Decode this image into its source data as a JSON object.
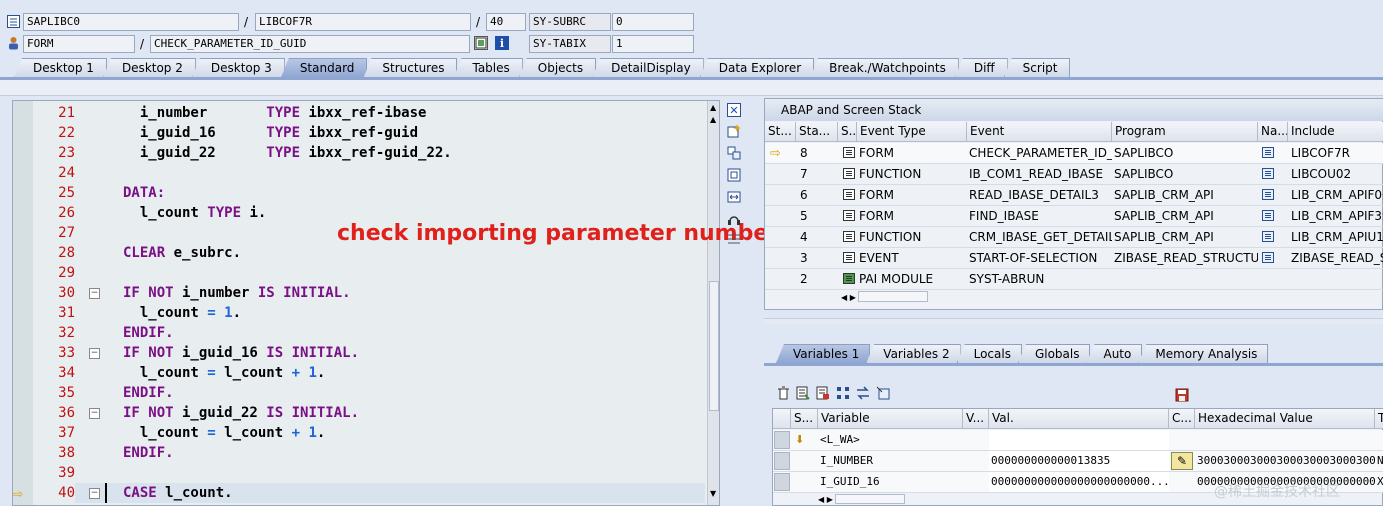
{
  "header": {
    "program": "SAPLIBC0",
    "include": "LIBCOF7R",
    "line": "40",
    "sysubrc_label": "SY-SUBRC",
    "sysubrc_value": "0",
    "type": "FORM",
    "routine": "CHECK_PARAMETER_ID_GUID",
    "sytabix_label": "SY-TABIX",
    "sytabix_value": "1"
  },
  "tabs": [
    "Desktop 1",
    "Desktop 2",
    "Desktop 3",
    "Standard",
    "Structures",
    "Tables",
    "Objects",
    "DetailDisplay",
    "Data Explorer",
    "Break./Watchpoints",
    "Diff",
    "Script"
  ],
  "code": {
    "line_numbers": [
      "21",
      "22",
      "23",
      "24",
      "25",
      "26",
      "27",
      "28",
      "29",
      "30",
      "31",
      "32",
      "33",
      "34",
      "35",
      "36",
      "37",
      "38",
      "39",
      "40"
    ],
    "annotation": "check importing parameter number"
  },
  "stack": {
    "title": "ABAP and Screen Stack",
    "headers": [
      "St...",
      "Sta...",
      "S...",
      "Event Type",
      "Event",
      "Program",
      "Na...",
      "Include"
    ],
    "rows": [
      {
        "level": "8",
        "event_type": "FORM",
        "event": "CHECK_PARAMETER_ID_...",
        "program": "SAPLIBCO",
        "include": "LIBCOF7R"
      },
      {
        "level": "7",
        "event_type": "FUNCTION",
        "event": "IB_COM1_READ_IBASE",
        "program": "SAPLIBCO",
        "include": "LIBCOU02"
      },
      {
        "level": "6",
        "event_type": "FORM",
        "event": "READ_IBASE_DETAIL3",
        "program": "SAPLIB_CRM_API",
        "include": "LIB_CRM_APIF06"
      },
      {
        "level": "5",
        "event_type": "FORM",
        "event": "FIND_IBASE",
        "program": "SAPLIB_CRM_API",
        "include": "LIB_CRM_APIF39"
      },
      {
        "level": "4",
        "event_type": "FUNCTION",
        "event": "CRM_IBASE_GET_DETAIL",
        "program": "SAPLIB_CRM_API",
        "include": "LIB_CRM_APIU17"
      },
      {
        "level": "3",
        "event_type": "EVENT",
        "event": "START-OF-SELECTION",
        "program": "ZIBASE_READ_STRUCTU...",
        "include": "ZIBASE_READ_ST"
      },
      {
        "level": "2",
        "event_type": "PAI MODULE",
        "event": "SYST-ABRUN",
        "program": "",
        "include": ""
      }
    ]
  },
  "vartabs": [
    "Variables 1",
    "Variables 2",
    "Locals",
    "Globals",
    "Auto",
    "Memory Analysis"
  ],
  "vars": {
    "headers": [
      "S...",
      "Variable",
      "V...",
      "Val.",
      "C...",
      "Hexadecimal Value",
      "T"
    ],
    "rows": [
      {
        "name": "<L_WA>",
        "value": "",
        "hex": "",
        "t": ""
      },
      {
        "name": "I_NUMBER",
        "value": "000000000000013835",
        "hex": "30003000300030003000300030003000...",
        "t": "N"
      },
      {
        "name": "I_GUID_16",
        "value": "000000000000000000000000...",
        "hex": "000000000000000000000000000000...",
        "t": "X"
      }
    ]
  },
  "watermark": "@稀土掘金技术社区"
}
